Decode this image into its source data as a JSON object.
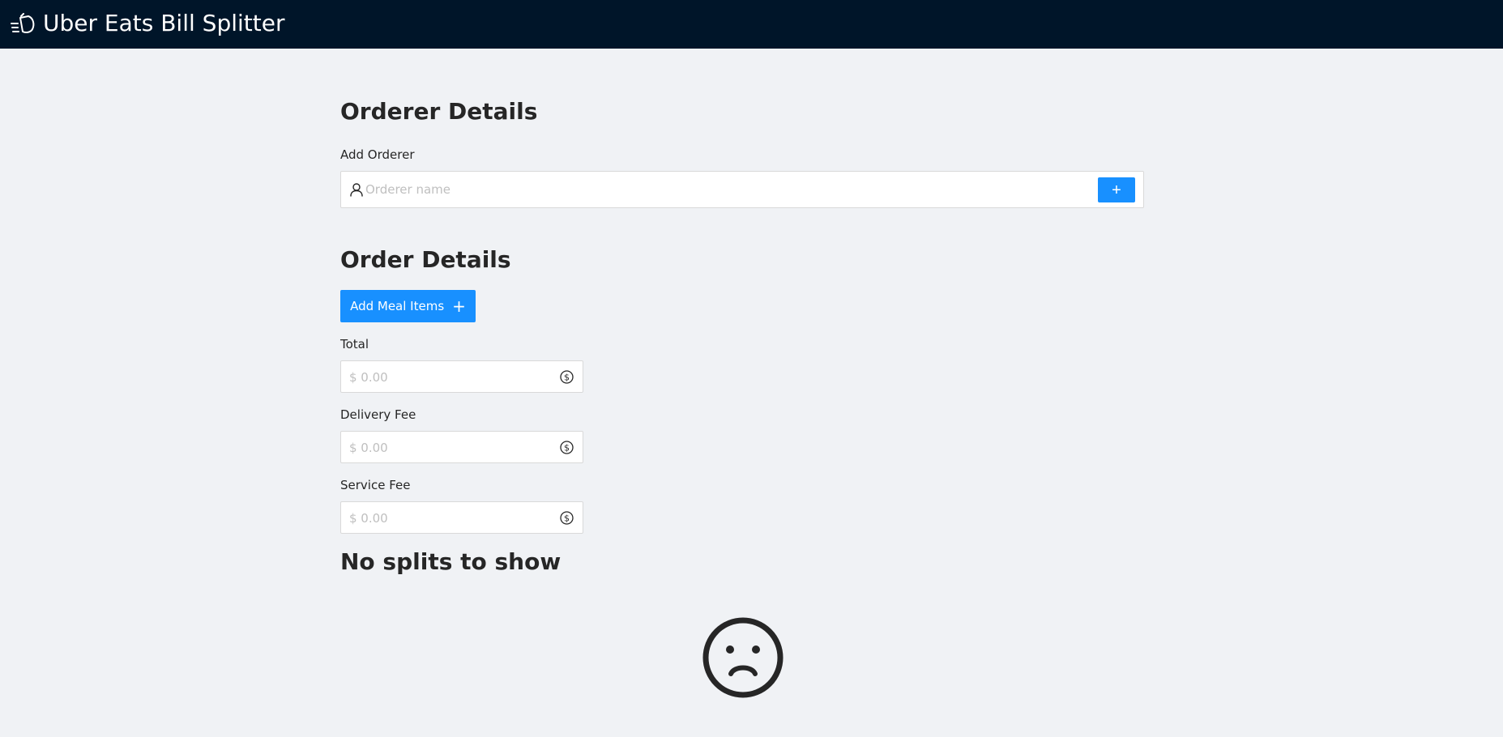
{
  "app": {
    "title": "Uber Eats Bill Splitter",
    "logo_icon": "fast-food-bag-icon"
  },
  "orderer_section": {
    "title": "Orderer Details",
    "add_label": "Add Orderer",
    "input_placeholder": "Orderer name",
    "input_icon": "user-icon",
    "add_button_label": "+"
  },
  "order_section": {
    "title": "Order Details",
    "add_meal_label": "Add Meal Items",
    "add_meal_icon": "+",
    "fields": [
      {
        "label": "Total",
        "placeholder": "$ 0.00",
        "icon": "dollar-circle-icon"
      },
      {
        "label": "Delivery Fee",
        "placeholder": "$ 0.00",
        "icon": "dollar-circle-icon"
      },
      {
        "label": "Service Fee",
        "placeholder": "$ 0.00",
        "icon": "dollar-circle-icon"
      }
    ]
  },
  "splits": {
    "empty_title": "No splits to show",
    "empty_icon": "frown-face-icon"
  },
  "colors": {
    "navbar": "#001529",
    "primary": "#1890ff",
    "background": "#f0f2f5"
  }
}
